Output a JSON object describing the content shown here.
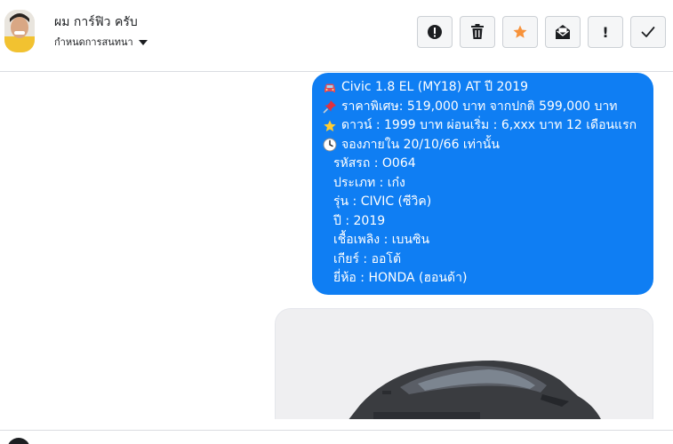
{
  "header": {
    "contact_name": "ผม การ์ฟิว ครับ",
    "assign_label": "กำหนดการสนทนา",
    "toolbar": [
      {
        "name": "spam-button",
        "icon": "alert-circle-icon",
        "glyph": ""
      },
      {
        "name": "delete-button",
        "icon": "trash-icon",
        "glyph": ""
      },
      {
        "name": "star-button",
        "icon": "star-icon",
        "glyph": ""
      },
      {
        "name": "mark-unread-button",
        "icon": "envelope-icon",
        "glyph": ""
      },
      {
        "name": "follow-up-button",
        "icon": "exclamation-icon",
        "glyph": "!"
      },
      {
        "name": "mark-done-button",
        "icon": "check-icon",
        "glyph": ""
      }
    ]
  },
  "message": {
    "lines": [
      {
        "icon": "car-icon",
        "text": "Civic 1.8 EL (MY18) AT ปี 2019"
      },
      {
        "icon": "pushpin-icon",
        "text": "ราคาพิเศษ: 519,000 บาท จากปกติ 599,000 บาท"
      },
      {
        "icon": "star-icon",
        "text": "ดาวน์ : 1999 บาท ผ่อนเริ่ม : 6,xxx บาท 12 เดือนแรก"
      },
      {
        "icon": "clock-icon",
        "text": "จองภายใน 20/10/66 เท่านั้น"
      },
      {
        "icon": "",
        "text": "รหัสรถ : O064"
      },
      {
        "icon": "",
        "text": "ประเภท : เก๋ง"
      },
      {
        "icon": "",
        "text": "รุ่น : CIVIC (ซีวิค)"
      },
      {
        "icon": "",
        "text": "ปี : 2019"
      },
      {
        "icon": "",
        "text": "เชื้อเพลิง : เบนซิน"
      },
      {
        "icon": "",
        "text": "เกียร์ : ออโต้"
      },
      {
        "icon": "",
        "text": "ยี่ห้อ : HONDA (ฮอนด้า)"
      }
    ]
  },
  "colors": {
    "bubble": "#0f7ef3",
    "star_accent": "#f7923a"
  }
}
